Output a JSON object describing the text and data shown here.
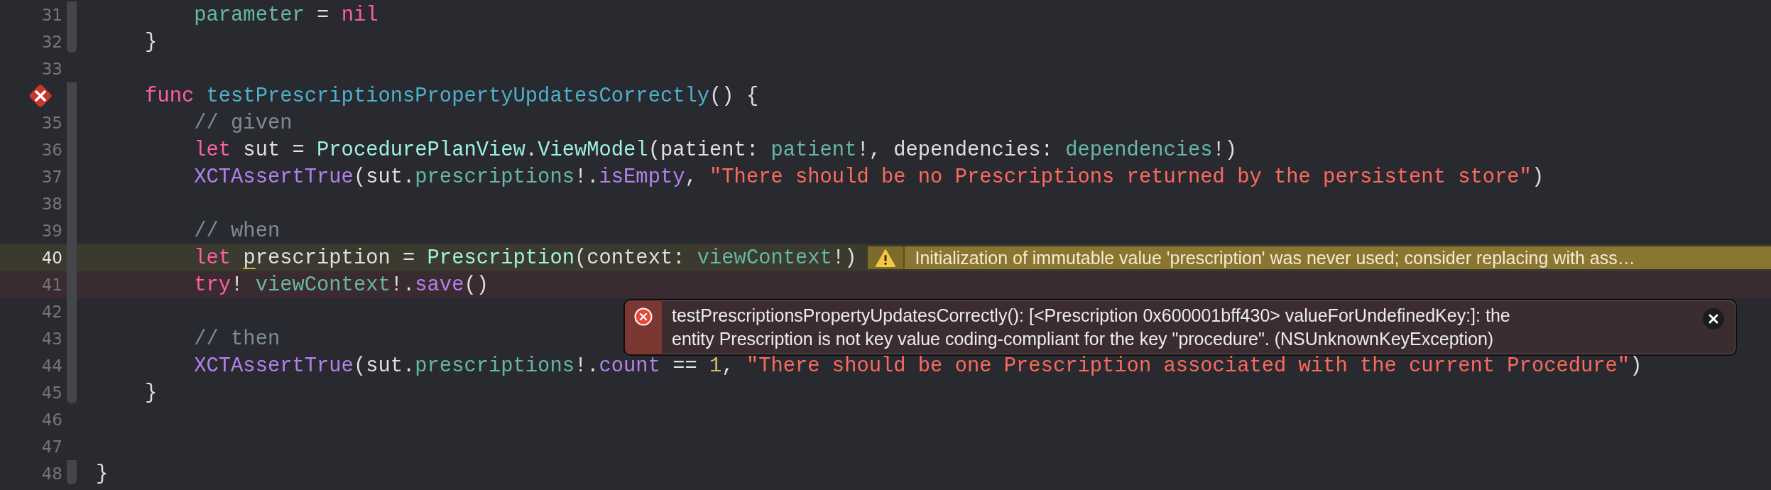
{
  "editor": {
    "lines": [
      {
        "number": "31",
        "kind": "plain",
        "fold": true,
        "tokens": [
          {
            "kind": "prop",
            "text": "        parameter"
          },
          {
            "kind": "plain",
            "text": " = "
          },
          {
            "kind": "kw",
            "text": "nil"
          }
        ]
      },
      {
        "number": "32",
        "kind": "plain",
        "fold": true,
        "tokens": [
          {
            "kind": "plain",
            "text": "    }"
          }
        ]
      },
      {
        "number": "33",
        "kind": "plain",
        "fold": false
      },
      {
        "kind": "failure",
        "fold": true,
        "tokens": [
          {
            "kind": "kw",
            "text": "    func "
          },
          {
            "kind": "decl",
            "text": "testPrescriptionsPropertyUpdatesCorrectly"
          },
          {
            "kind": "plain",
            "text": "() {"
          }
        ]
      },
      {
        "number": "35",
        "kind": "plain",
        "fold": true,
        "tokens": [
          {
            "kind": "cmt",
            "text": "        // given"
          }
        ]
      },
      {
        "number": "36",
        "kind": "plain",
        "fold": true,
        "tokens": [
          {
            "kind": "kw",
            "text": "        let"
          },
          {
            "kind": "plain",
            "text": " sut = "
          },
          {
            "kind": "type",
            "text": "ProcedurePlanView"
          },
          {
            "kind": "plain",
            "text": "."
          },
          {
            "kind": "type",
            "text": "ViewModel"
          },
          {
            "kind": "plain",
            "text": "(patient: "
          },
          {
            "kind": "prop",
            "text": "patient"
          },
          {
            "kind": "plain",
            "text": "!, dependencies: "
          },
          {
            "kind": "prop",
            "text": "dependencies"
          },
          {
            "kind": "plain",
            "text": "!)"
          }
        ]
      },
      {
        "number": "37",
        "kind": "plain",
        "fold": true,
        "tokens": [
          {
            "kind": "sys",
            "text": "        XCTAssertTrue"
          },
          {
            "kind": "plain",
            "text": "(sut."
          },
          {
            "kind": "prop",
            "text": "prescriptions"
          },
          {
            "kind": "plain",
            "text": "!."
          },
          {
            "kind": "sys",
            "text": "isEmpty"
          },
          {
            "kind": "plain",
            "text": ", "
          },
          {
            "kind": "str",
            "text": "\"There should be no Prescriptions returned by the persistent store\""
          },
          {
            "kind": "plain",
            "text": ")"
          }
        ]
      },
      {
        "number": "38",
        "kind": "plain",
        "fold": true
      },
      {
        "number": "39",
        "kind": "plain",
        "fold": true,
        "tokens": [
          {
            "kind": "cmt",
            "text": "        // when"
          }
        ]
      },
      {
        "number": "40",
        "kind": "warning",
        "fold": true,
        "annotation": "Initialization of immutable value 'prescription' was never used; consider replacing with ass…",
        "tokens": [
          {
            "kind": "kw",
            "text": "        let "
          },
          {
            "kind": "warned",
            "text": "p"
          },
          {
            "kind": "plain",
            "text": "rescription = "
          },
          {
            "kind": "type",
            "text": "Prescription"
          },
          {
            "kind": "plain",
            "text": "(context: "
          },
          {
            "kind": "prop",
            "text": "viewContext"
          },
          {
            "kind": "plain",
            "text": "!)"
          }
        ]
      },
      {
        "number": "41",
        "kind": "error",
        "fold": true,
        "tokens": [
          {
            "kind": "kw",
            "text": "        try"
          },
          {
            "kind": "plain",
            "text": "! "
          },
          {
            "kind": "prop",
            "text": "viewContext"
          },
          {
            "kind": "plain",
            "text": "!."
          },
          {
            "kind": "sys",
            "text": "save"
          },
          {
            "kind": "plain",
            "text": "()"
          }
        ]
      },
      {
        "number": "42",
        "kind": "plain",
        "fold": true
      },
      {
        "number": "43",
        "kind": "plain",
        "fold": true,
        "tokens": [
          {
            "kind": "cmt",
            "text": "        // then"
          }
        ]
      },
      {
        "number": "44",
        "kind": "plain",
        "fold": true,
        "tokens": [
          {
            "kind": "sys",
            "text": "        XCTAssertTrue"
          },
          {
            "kind": "plain",
            "text": "(sut."
          },
          {
            "kind": "prop",
            "text": "prescriptions"
          },
          {
            "kind": "plain",
            "text": "!."
          },
          {
            "kind": "sys",
            "text": "count"
          },
          {
            "kind": "plain",
            "text": " == "
          },
          {
            "kind": "num",
            "text": "1"
          },
          {
            "kind": "plain",
            "text": ", "
          },
          {
            "kind": "str",
            "text": "\"There should be one Prescription associated with the current Procedure\""
          },
          {
            "kind": "plain",
            "text": ")"
          }
        ]
      },
      {
        "number": "45",
        "kind": "plain",
        "fold": true,
        "tokens": [
          {
            "kind": "plain",
            "text": "    }"
          }
        ]
      },
      {
        "number": "46",
        "kind": "plain",
        "fold": false
      },
      {
        "number": "47",
        "kind": "plain",
        "fold": false
      },
      {
        "number": "48",
        "kind": "plain",
        "fold": true,
        "tokens": [
          {
            "kind": "plain",
            "text": "}"
          }
        ]
      }
    ]
  },
  "error_popup": {
    "message_lines": [
      "testPrescriptionsPropertyUpdatesCorrectly(): [<Prescription 0x600001bff430> valueForUndefinedKey:]: the",
      "entity Prescription is not key value coding-compliant for the key \"procedure\". (NSUnknownKeyException)"
    ]
  }
}
